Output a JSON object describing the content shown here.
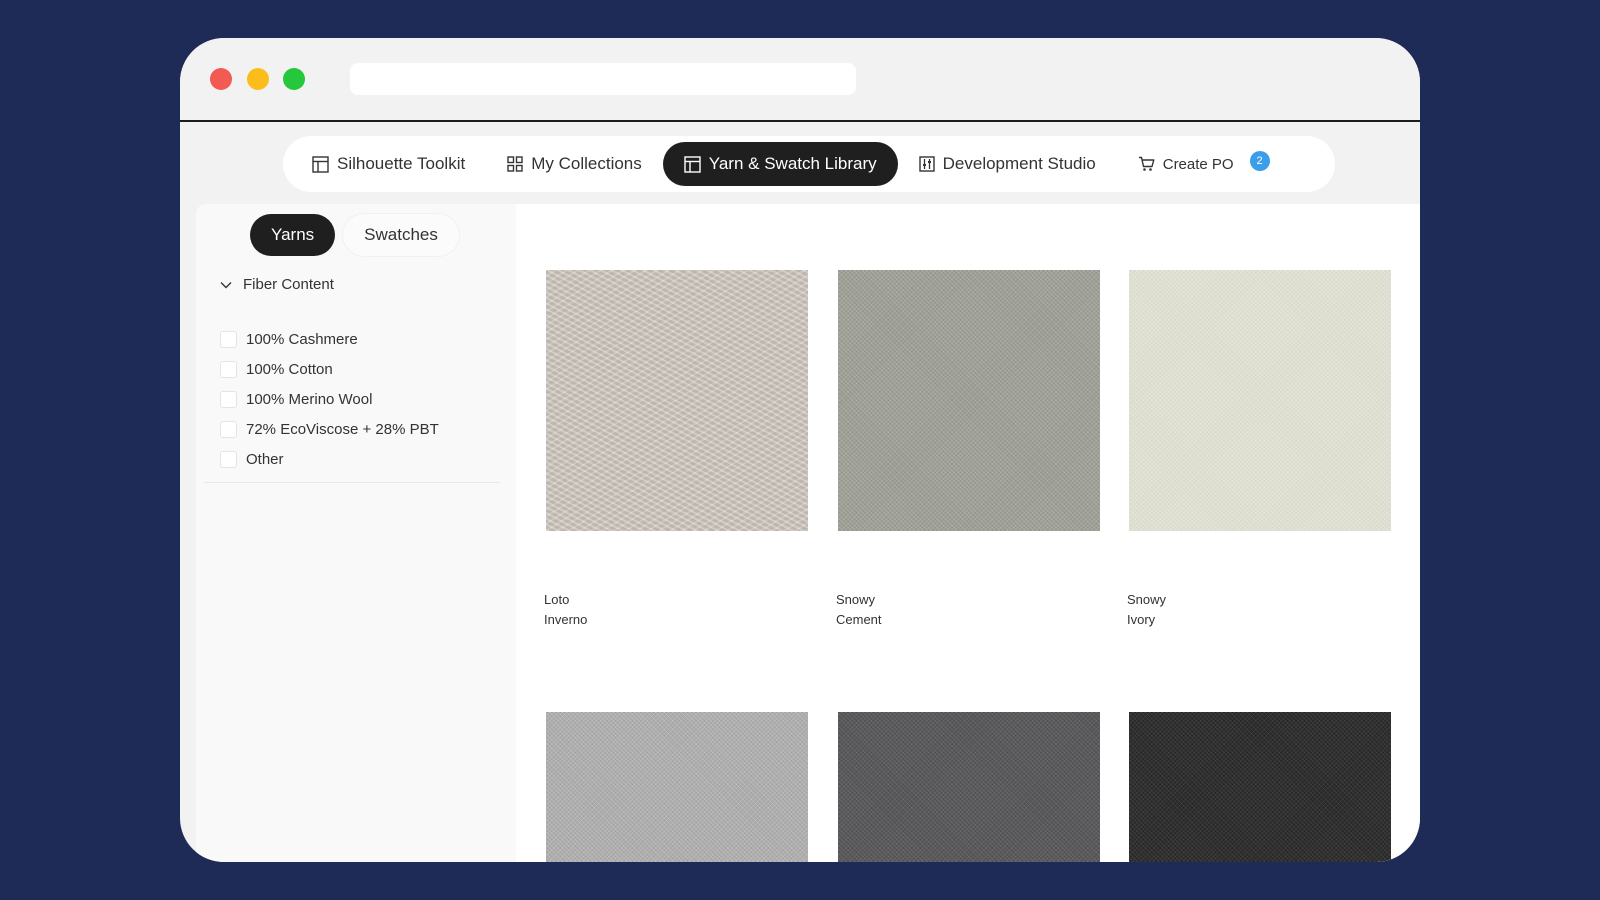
{
  "colors": {
    "background": "#1d2b56",
    "window": "#f2f2f2",
    "close": "#f25a52",
    "minimize": "#fbbd1b",
    "maximize": "#25c73c",
    "active_tab": "#1f1f1f",
    "badge": "#3b9eea"
  },
  "browser": {
    "address": ""
  },
  "nav": {
    "items": [
      {
        "label": "Silhouette Toolkit",
        "icon": "layout-icon"
      },
      {
        "label": "My Collections",
        "icon": "grid-icon"
      },
      {
        "label": "Yarn & Swatch Library",
        "icon": "layout-icon",
        "active": true
      },
      {
        "label": "Development Studio",
        "icon": "sliders-icon"
      },
      {
        "label": "Create PO",
        "icon": "cart-icon",
        "badge": "2"
      }
    ]
  },
  "sidebar": {
    "tabs": [
      {
        "label": "Yarns",
        "active": true
      },
      {
        "label": "Swatches",
        "active": false
      }
    ],
    "filter": {
      "title": "Fiber Content",
      "icon": "chevron-down-icon",
      "options": [
        "100% Cashmere",
        "100% Cotton",
        "100% Merino Wool",
        "72% EcoViscose + 28% PBT",
        "Other"
      ]
    }
  },
  "products": [
    {
      "line1": "Loto",
      "line2": "Inverno",
      "color": "#cfc8be"
    },
    {
      "line1": "Snowy",
      "line2": "Cement",
      "color": "#a8aaa0"
    },
    {
      "line1": "Snowy",
      "line2": "Ivory",
      "color": "#e6e7d9"
    },
    {
      "line1": "",
      "line2": "",
      "color": "#b9b9ba"
    },
    {
      "line1": "",
      "line2": "",
      "color": "#5c5c5e"
    },
    {
      "line1": "",
      "line2": "",
      "color": "#2d2d2d"
    }
  ]
}
